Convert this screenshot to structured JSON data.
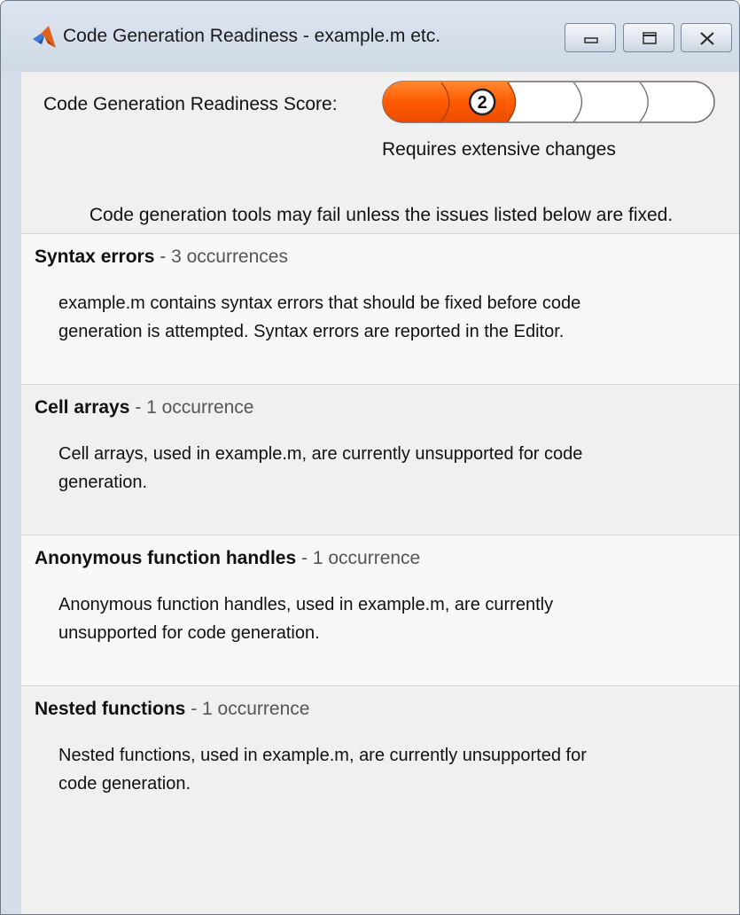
{
  "window": {
    "title": "Code Generation Readiness - example.m etc.",
    "app_icon": "matlab-icon",
    "controls": [
      "minimize-icon",
      "maximize-icon",
      "close-icon"
    ]
  },
  "score": {
    "label": "Code Generation Readiness Score:",
    "value": 2,
    "max": 5,
    "value_text": "2",
    "caption": "Requires extensive changes",
    "fill_color": "#ff5a00",
    "empty_color": "#ffffff"
  },
  "warning": "Code generation tools may fail unless the issues listed below are fixed.",
  "issues": [
    {
      "title": "Syntax errors",
      "separator": " - ",
      "count": "3 occurrences",
      "lines": [
        "example.m contains syntax errors that should be fixed before code",
        "generation is attempted. Syntax errors are reported in the Editor."
      ]
    },
    {
      "title": "Cell arrays",
      "separator": " - ",
      "count": "1 occurrence",
      "lines": [
        "Cell arrays, used in example.m, are currently unsupported for code",
        "generation."
      ]
    },
    {
      "title": "Anonymous function handles",
      "separator": " - ",
      "count": "1 occurrence",
      "lines": [
        "Anonymous function handles, used in example.m, are currently",
        "unsupported for code generation."
      ]
    },
    {
      "title": "Nested functions",
      "separator": " - ",
      "count": "1 occurrence",
      "lines": [
        "Nested functions, used in example.m, are currently unsupported for",
        "code generation."
      ]
    }
  ]
}
